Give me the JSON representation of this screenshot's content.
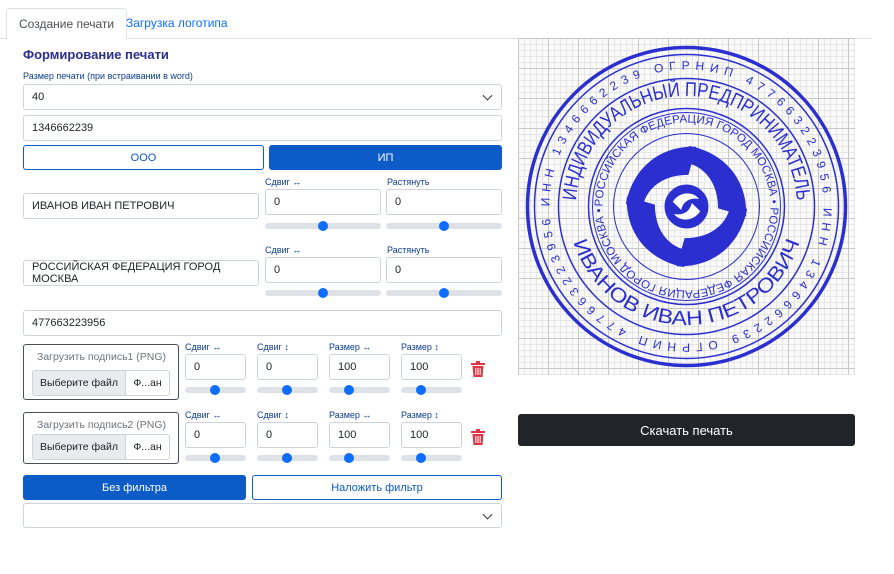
{
  "tabs": [
    {
      "label": "Создание печати",
      "active": true
    },
    {
      "label": "Загрузка логотипа",
      "active": false
    }
  ],
  "form": {
    "title": "Формирование печати",
    "size_label": "Размер печати (при встраивании в word)",
    "size_value": "40",
    "inn_value": "1346662239",
    "type_ooo": "ООО",
    "type_ip": "ИП",
    "name_value": "ИВАНОВ ИВАН ПЕТРОВИЧ",
    "region_value": "РОССИЙСКАЯ ФЕДЕРАЦИЯ ГОРОД МОСКВА",
    "ogrn_value": "477663223956",
    "shift_h_label": "Сдвиг ↔",
    "stretch_label": "Растянуть",
    "name_shift": "0",
    "name_stretch": "0",
    "region_shift": "0",
    "region_stretch": "0"
  },
  "signatures": [
    {
      "upload_label": "Загрузить подпись1 (PNG)",
      "choose": "Выберите файл",
      "file": "Ф...ан",
      "labels": [
        "Сдвиг ↔",
        "Сдвиг ↕",
        "Размер ↔",
        "Размер ↕"
      ],
      "values": [
        "0",
        "0",
        "100",
        "100"
      ]
    },
    {
      "upload_label": "Загрузить подпись2 (PNG)",
      "choose": "Выберите файл",
      "file": "Ф...ан",
      "labels": [
        "Сдвиг ↔",
        "Сдвиг ↕",
        "Размер ↔",
        "Размер ↕"
      ],
      "values": [
        "0",
        "0",
        "100",
        "100"
      ]
    }
  ],
  "filters": {
    "no_filter": "Без фильтра",
    "apply_filter": "Наложить фильтр",
    "filter_select": ""
  },
  "stamp": {
    "outer_text": "ИНН 1346662239 ОГРНИП 477663223956 ИНН 1346662239 ОГРНИП 477663223956",
    "top_text": "ИНДИВИДУАЛЬНЫЙ ПРЕДПРИНИМАТЕЛЬ",
    "bottom_text": "ИВАНОВ ИВАН ПЕТРОВИЧ",
    "inner_text": "РОССИЙСКАЯ ФЕДЕРАЦИЯ ГОРОД МОСКВА • РОССИЙСКАЯ ФЕДЕРАЦИЯ ГОРОД МОСКВА •",
    "color": "#2b2fd0",
    "logo_icon": "swirl-logo-icon"
  },
  "download_label": "Скачать печать",
  "colors": {
    "primary": "#0d5bc6",
    "dark": "#212529",
    "stamp": "#2b2fd0"
  }
}
